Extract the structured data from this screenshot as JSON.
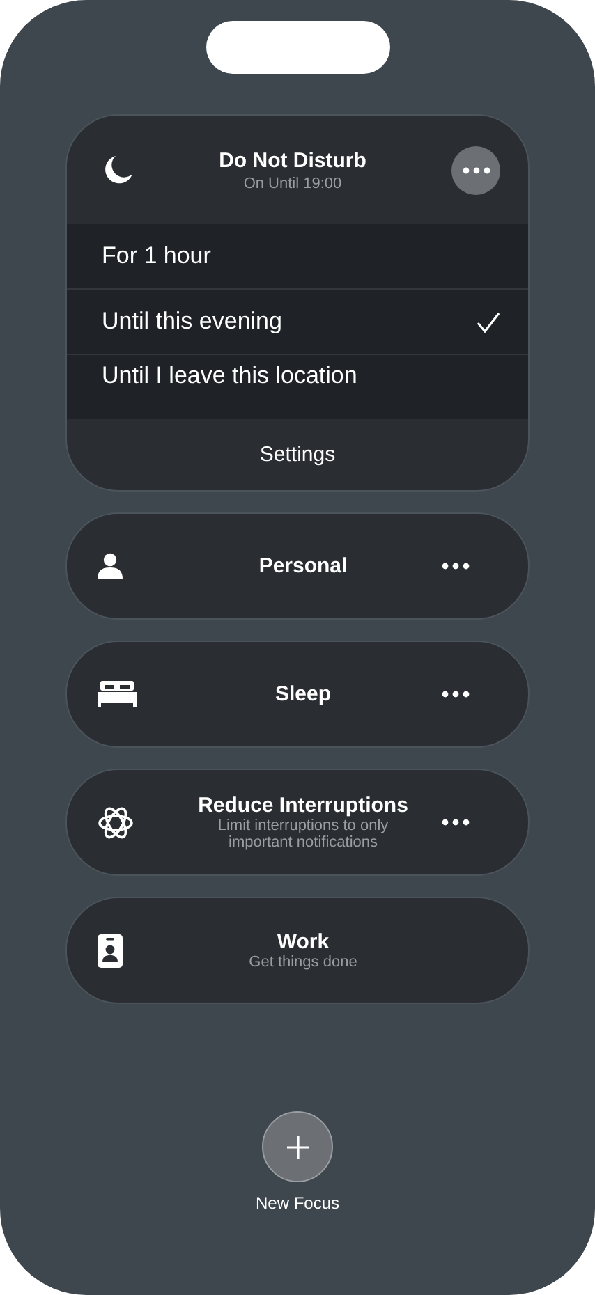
{
  "active_focus": {
    "title": "Do Not Disturb",
    "subtitle": "On Until 19:00",
    "options": [
      {
        "label": "For 1 hour",
        "selected": false
      },
      {
        "label": "Until this evening",
        "selected": true
      },
      {
        "label": "Until I leave this location",
        "selected": false
      }
    ],
    "settings": "Settings"
  },
  "focus_modes": [
    {
      "title": "Personal",
      "more_button": true
    },
    {
      "title": "Sleep",
      "more_button": true
    },
    {
      "title": "Reduce Interruptions",
      "subtitle": "Limit interruptions to only important notifications",
      "more_button": true
    },
    {
      "title": "Work",
      "subtitle": "Get things done",
      "more_button": false
    }
  ],
  "new_focus": {
    "label": "New Focus"
  }
}
